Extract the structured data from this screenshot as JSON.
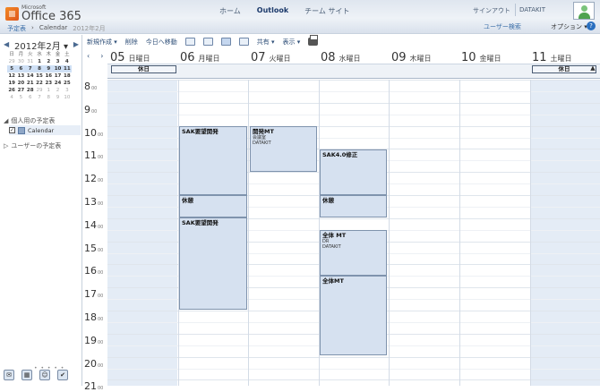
{
  "header": {
    "logo_ms": "Microsoft",
    "logo_name": "Office 365",
    "nav": [
      "ホーム",
      "Outlook",
      "チーム サイト"
    ],
    "sign_out": "サインアウト",
    "username": "DATAKIT",
    "user_search": "ユーザー検索",
    "options": "オプション ▾",
    "help": "?"
  },
  "breadcrumb": {
    "root": "予定表",
    "sep": "›",
    "current": "Calendar",
    "month": "2012年2月"
  },
  "mini_calendar": {
    "prev": "◀",
    "title": "2012年2月 ▾",
    "next": "▶",
    "dow": [
      "日",
      "月",
      "火",
      "水",
      "木",
      "金",
      "土"
    ],
    "weeks": [
      [
        "29",
        "30",
        "31",
        "1",
        "2",
        "3",
        "4"
      ],
      [
        "5",
        "6",
        "7",
        "8",
        "9",
        "10",
        "11"
      ],
      [
        "12",
        "13",
        "14",
        "15",
        "16",
        "17",
        "18"
      ],
      [
        "19",
        "20",
        "21",
        "22",
        "23",
        "24",
        "25"
      ],
      [
        "26",
        "27",
        "28",
        "29",
        "1",
        "2",
        "3"
      ],
      [
        "4",
        "5",
        "6",
        "7",
        "8",
        "9",
        "10"
      ]
    ]
  },
  "sidebar": {
    "my_calendars": "個人用の予定表",
    "calendar_item": "Calendar",
    "checked": "✓",
    "other_calendars": "ユーザーの予定表",
    "dots": "• • • • •"
  },
  "toolbar": {
    "new": "新規作成 ▾",
    "delete": "削除",
    "today": "今日へ移動",
    "share": "共有 ▾",
    "view": "表示 ▾"
  },
  "calendar": {
    "prev": "‹",
    "next": "›",
    "days": [
      {
        "num": "05",
        "label": "日曜日"
      },
      {
        "num": "06",
        "label": "月曜日"
      },
      {
        "num": "07",
        "label": "火曜日"
      },
      {
        "num": "08",
        "label": "水曜日"
      },
      {
        "num": "09",
        "label": "木曜日"
      },
      {
        "num": "10",
        "label": "金曜日"
      },
      {
        "num": "11",
        "label": "土曜日"
      }
    ],
    "holiday_label": "休日",
    "hours": [
      "8",
      "9",
      "10",
      "11",
      "12",
      "13",
      "14",
      "15",
      "16",
      "17",
      "18",
      "19",
      "20",
      "21"
    ],
    "minutes": "00",
    "events": {
      "mon1": {
        "title": "SAK要望開発"
      },
      "mon2": {
        "title": "休憩"
      },
      "mon3": {
        "title": "SAK要望開発"
      },
      "tue1": {
        "title": "開発MT",
        "line1": "会議室",
        "line2": "DATAKIT"
      },
      "wed1": {
        "title": "SAK4.0修正"
      },
      "wed2": {
        "title": "休憩"
      },
      "wed3": {
        "title": "全体 MT",
        "line1": "DR",
        "line2": "DATAKIT"
      },
      "wed4": {
        "title": "全体MT"
      }
    }
  },
  "colors": {
    "accent": "#1c3a6b",
    "event_bg": "#d6e1f0",
    "weekend_bg": "#e4ecf6"
  }
}
